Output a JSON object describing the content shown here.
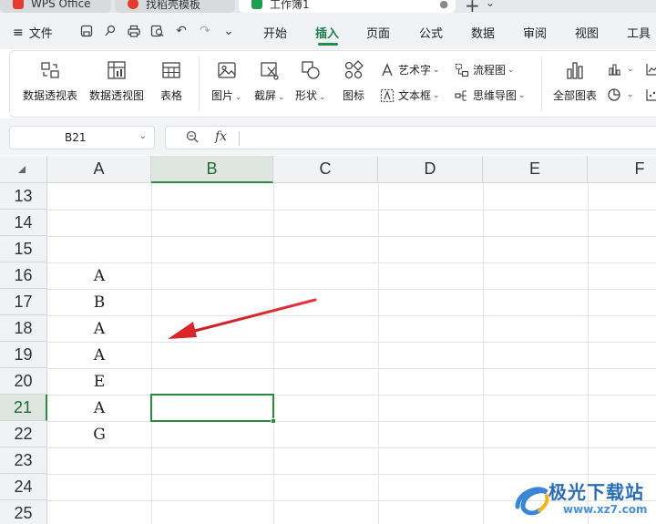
{
  "tabs": [
    {
      "label": "WPS Office",
      "color": "#e33b2e"
    },
    {
      "label": "找稻壳模板",
      "color": "#e33b2e"
    },
    {
      "label": "工作簿1",
      "color": "#1f9d55"
    }
  ],
  "menu": {
    "file_label": "文件",
    "items": [
      "开始",
      "插入",
      "页面",
      "公式",
      "数据",
      "审阅",
      "视图",
      "工具"
    ],
    "active": "插入"
  },
  "ribbon": {
    "pivot_table": "数据透视表",
    "pivot_chart": "数据透视图",
    "table": "表格",
    "picture": "图片",
    "screenshot": "截屏",
    "shape": "形状",
    "icon": "图标",
    "art_text": "艺术字",
    "text_box": "文本框",
    "flowchart": "流程图",
    "mind_map": "思维导图",
    "all_charts": "全部图表"
  },
  "formula_bar": {
    "name_box": "B21",
    "fx_label": "fx",
    "formula": ""
  },
  "grid": {
    "columns": [
      "A",
      "B",
      "C",
      "D",
      "E",
      "F"
    ],
    "selected_column": "B",
    "rows": [
      "13",
      "14",
      "15",
      "16",
      "17",
      "18",
      "19",
      "20",
      "21",
      "22",
      "23",
      "24",
      "25"
    ],
    "selected_row": "21",
    "cells_A": [
      "",
      "",
      "",
      "A",
      "B",
      "A",
      "A",
      "E",
      "A",
      "G",
      "",
      "",
      ""
    ],
    "active_cell": "B21",
    "accent_color": "#2b8a3e"
  },
  "annotation": {
    "arrow_color": "#d9262b"
  },
  "watermark": {
    "name": "极光下载站",
    "url": "www.xz7.com"
  }
}
